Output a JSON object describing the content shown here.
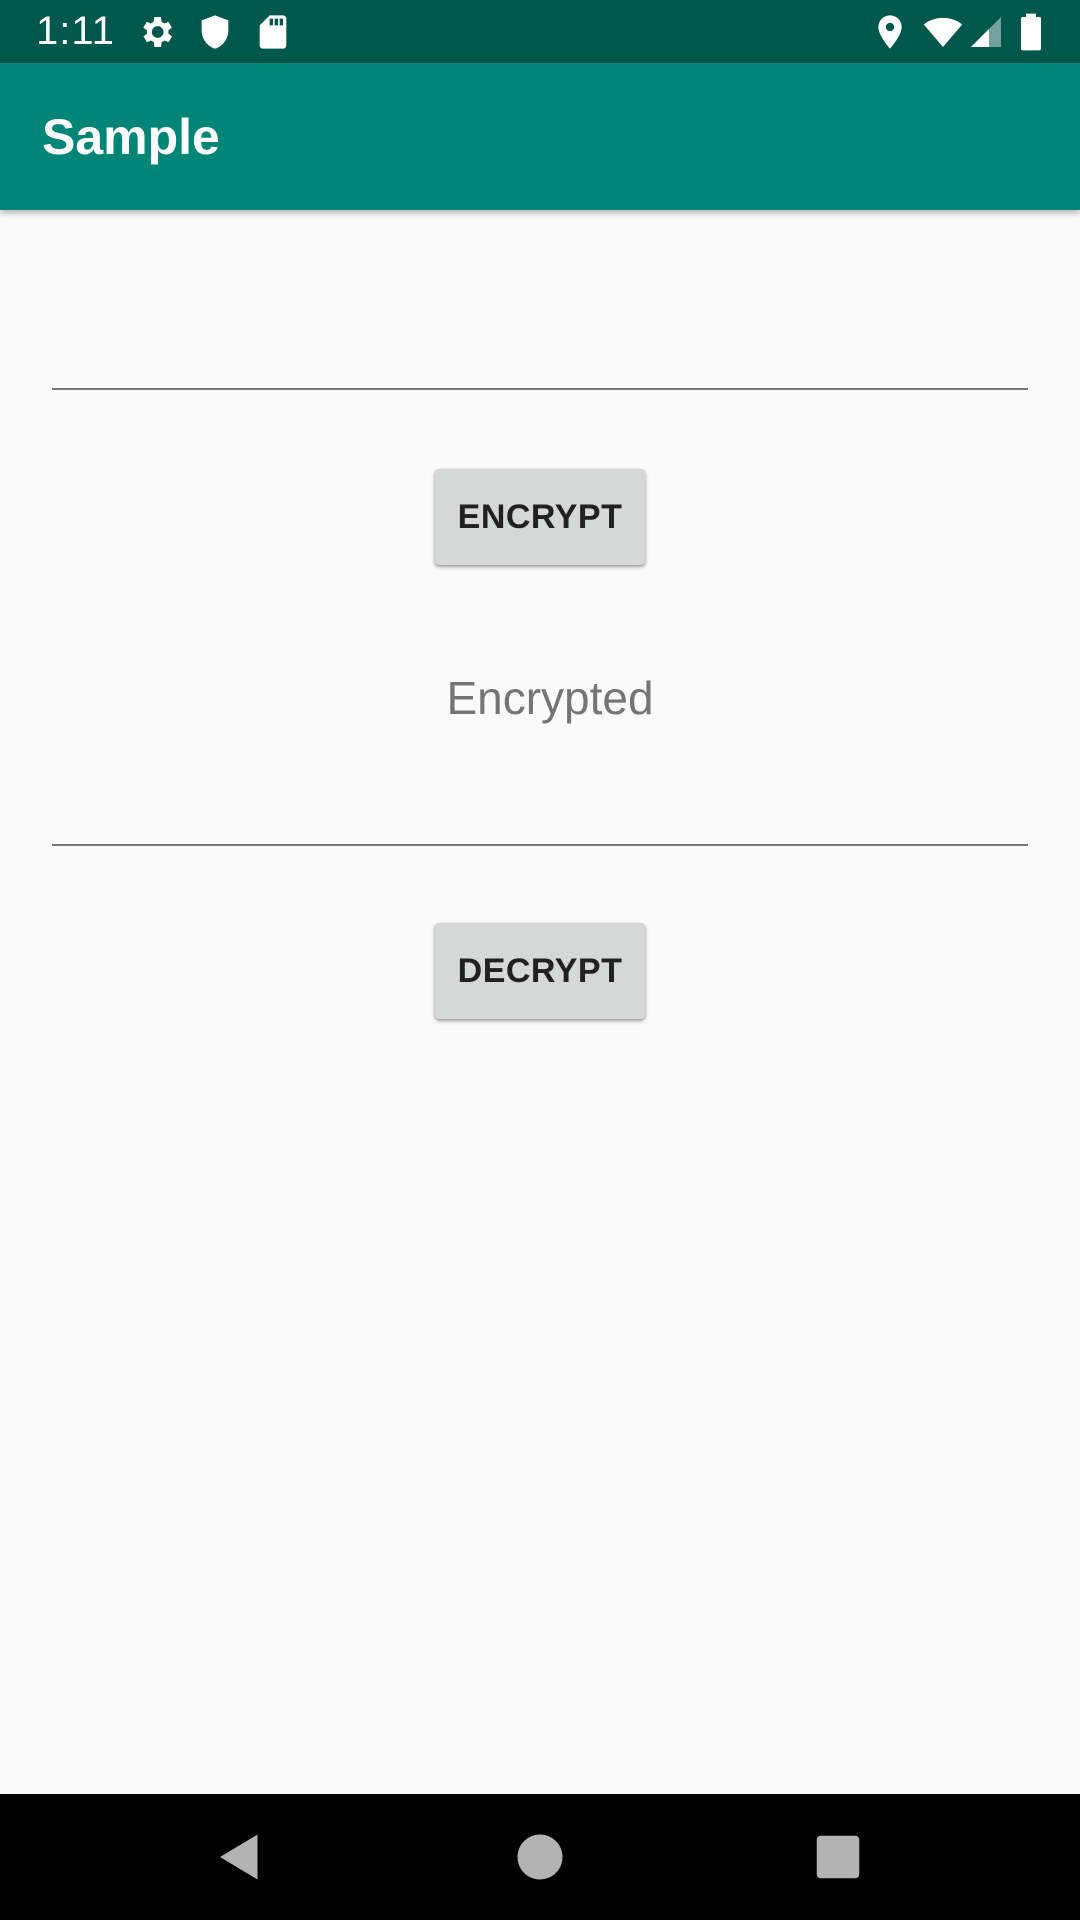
{
  "status_bar": {
    "time": "1:11",
    "icons": [
      "gear-icon",
      "shield-icon",
      "sd-card-icon",
      "location-icon",
      "wifi-icon",
      "signal-icon",
      "battery-icon"
    ]
  },
  "app_bar": {
    "title": "Sample",
    "color": "#008577"
  },
  "main": {
    "plain_text_field": {
      "value": "",
      "placeholder": ""
    },
    "encrypt_button": {
      "label": "ENCRYPT"
    },
    "encrypted_field": {
      "value": "",
      "placeholder": "Encrypted"
    },
    "decrypt_button": {
      "label": "DECRYPT"
    }
  },
  "nav_bar": {
    "buttons": [
      "back-icon",
      "home-icon",
      "recents-icon"
    ]
  },
  "colors": {
    "status_bar": "#00574b",
    "app_bar": "#008577",
    "button": "#d6d7d7",
    "background": "#fafafa"
  }
}
